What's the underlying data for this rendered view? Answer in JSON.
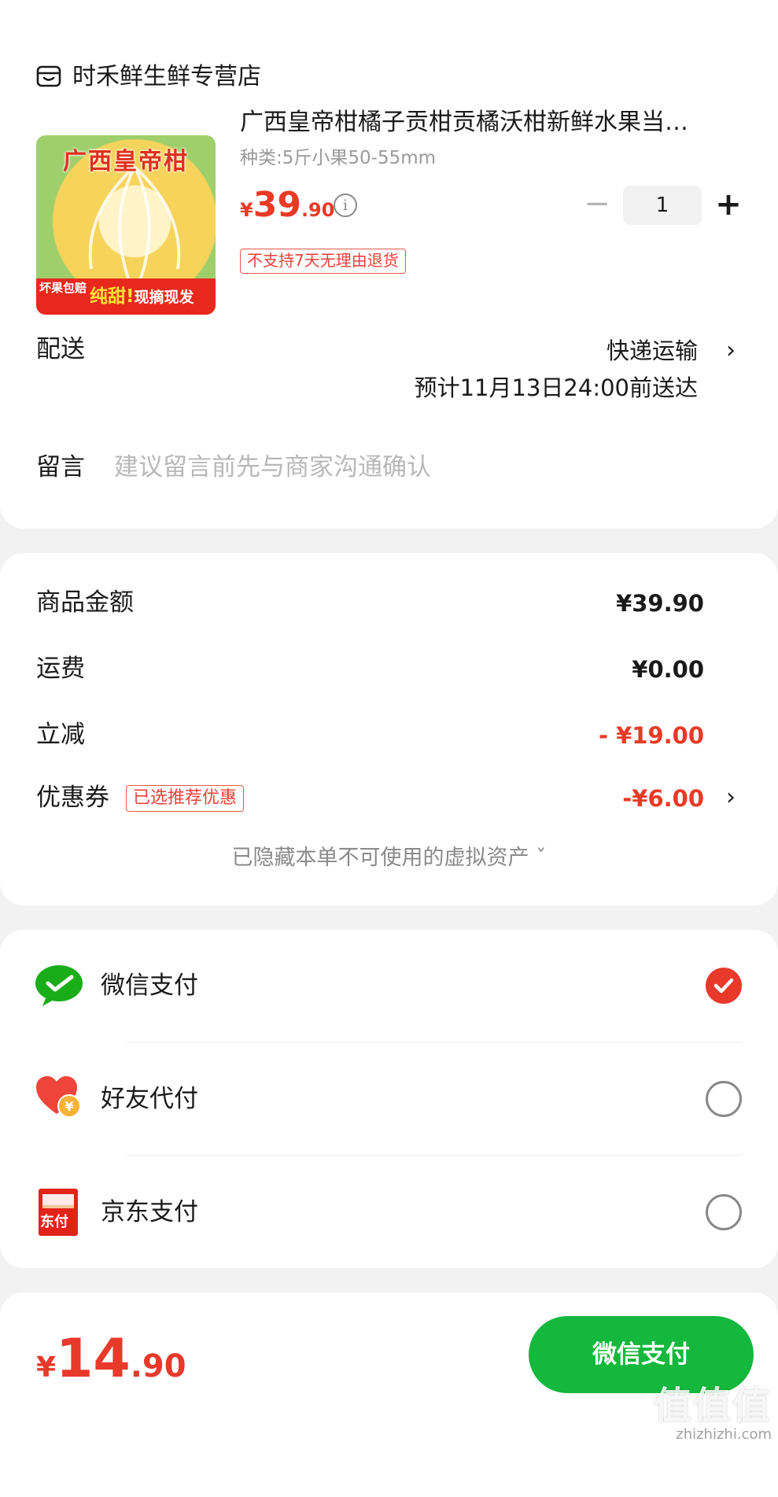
{
  "store": {
    "name": "时禾鲜生鲜专营店",
    "icon": "store-icon"
  },
  "product": {
    "title": "广西皇帝柑橘子贡柑贡橘沃柑新鲜水果当…",
    "spec": "种类:5斤小果50-55mm",
    "price_currency": "¥",
    "price_int": "39",
    "price_dec": ".90",
    "quantity": "1",
    "minus": "−",
    "plus": "+",
    "return_notice": "不支持7天无理由退货",
    "image_text": {
      "title": "广西皇帝柑",
      "badge": "坏果包赔",
      "tag_highlight": "纯甜!",
      "tag_rest": "现摘现发"
    }
  },
  "delivery": {
    "label": "配送",
    "method": "快递运输",
    "eta": "预计11月13日24:00前送达"
  },
  "message": {
    "label": "留言",
    "placeholder": "建议留言前先与商家沟通确认"
  },
  "prices": {
    "goods_label": "商品金额",
    "goods_value": "¥39.90",
    "shipping_label": "运费",
    "shipping_value": "¥0.00",
    "discount_label": "立减",
    "discount_value": "- ¥19.00",
    "coupon_label": "优惠券",
    "coupon_badge": "已选推荐优惠",
    "coupon_value": "-¥6.00",
    "hidden_assets": "已隐藏本单不可使用的虚拟资产 ˇ"
  },
  "payment": {
    "options": [
      {
        "label": "微信支付",
        "icon": "wechat-pay-icon",
        "selected": true
      },
      {
        "label": "好友代付",
        "icon": "friend-pay-icon",
        "selected": false
      },
      {
        "label": "京东支付",
        "icon": "jd-pay-icon",
        "selected": false,
        "icon_text": "东付"
      }
    ]
  },
  "bottom": {
    "currency": "¥",
    "total_int": "14",
    "total_dec": ".90",
    "pay_button": "微信支付"
  },
  "watermark": {
    "big": "值值值",
    "small": "zhizhizhi.com"
  },
  "colors": {
    "accent_red": "#e83a26",
    "wechat_green": "#14b83c",
    "background": "#f2f2f2"
  }
}
